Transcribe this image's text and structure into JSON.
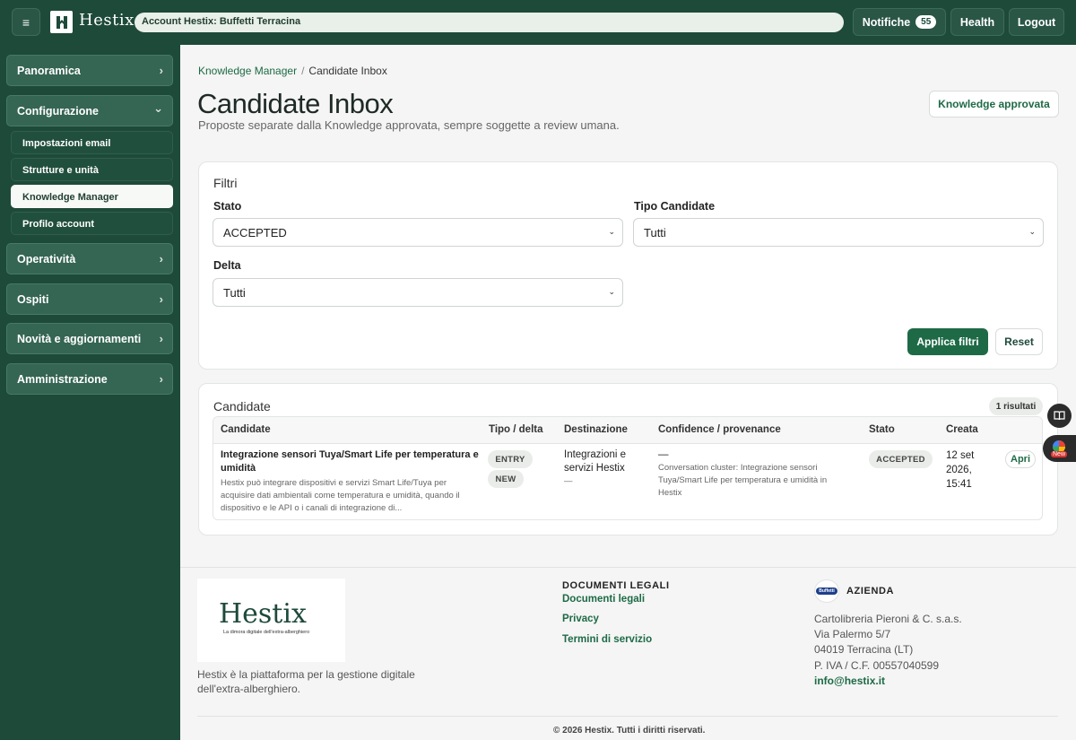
{
  "header": {
    "menu_icon": "hamburger-icon",
    "logo_text": "Hestix",
    "account_label": "Account Hestix:",
    "account_name": "Buffetti Terracina",
    "notifiche_label": "Notifiche",
    "notifiche_count": "55",
    "health_label": "Health",
    "logout_label": "Logout"
  },
  "sidebar": {
    "sections": [
      {
        "label": "Panoramica",
        "chevron": "›"
      },
      {
        "label": "Configurazione",
        "chevron": "⌄"
      },
      {
        "label": "Operatività",
        "chevron": "›"
      },
      {
        "label": "Ospiti",
        "chevron": "›"
      },
      {
        "label": "Novità e aggiornamenti",
        "chevron": "›"
      },
      {
        "label": "Amministrazione",
        "chevron": "›"
      }
    ],
    "sub_items": [
      {
        "label": "Impostazioni email"
      },
      {
        "label": "Strutture e unità"
      },
      {
        "label": "Knowledge Manager",
        "active": true
      },
      {
        "label": "Profilo account"
      }
    ]
  },
  "breadcrumb": {
    "parent": "Knowledge Manager",
    "separator": "/",
    "current": "Candidate Inbox"
  },
  "page": {
    "title": "Candidate Inbox",
    "subtitle": "Proposte separate dalla Knowledge approvata, sempre soggette a review umana.",
    "kb_button": "Knowledge approvata"
  },
  "filters": {
    "title": "Filtri",
    "stato_label": "Stato",
    "stato_value": "ACCEPTED",
    "tipo_label": "Tipo Candidate",
    "tipo_value": "Tutti",
    "delta_label": "Delta",
    "delta_value": "Tutti",
    "apply_label": "Applica filtri",
    "reset_label": "Reset"
  },
  "candidates": {
    "title": "Candidate",
    "count": "1 risultati",
    "columns": [
      "Candidate",
      "Tipo / delta",
      "Destinazione",
      "Confidence / provenance",
      "Stato",
      "Creata"
    ],
    "rows": [
      {
        "title": "Integrazione sensori Tuya/Smart Life per temperatura e umidità",
        "description": "Hestix può integrare dispositivi e servizi Smart Life/Tuya per acquisire dati ambientali come temperatura e umidità, quando il dispositivo e le API o i canali di integrazione di...",
        "tipo": "ENTRY",
        "delta": "NEW",
        "destinazione": "Integrazioni e servizi Hestix",
        "destinazione_sub": "—",
        "confidence": "—",
        "provenance": "Conversation cluster: Integrazione sensori Tuya/Smart Life per temperatura e umidità in Hestix",
        "stato": "ACCEPTED",
        "creata": "12 set 2026, 15:41",
        "action": "Apri"
      }
    ]
  },
  "footer": {
    "logo_word": "Hestix",
    "logo_tagline": "La dimora digitale dell'extra-alberghiero",
    "description": "Hestix è la piattaforma per la gestione digitale dell'extra-alberghiero.",
    "legal_head": "DOCUMENTI LEGALI",
    "legal_links": [
      "Documenti legali",
      "Privacy",
      "Termini di servizio"
    ],
    "company_head": "AZIENDA",
    "company_icon_text": "Buffetti",
    "company_lines": [
      "Cartolibreria Pieroni & C. s.a.s.",
      "Via Palermo 5/7",
      "04019 Terracina (LT)",
      "P. IVA / C.F. 00557040599"
    ],
    "company_email": "info@hestix.it",
    "copyright": "© 2026 Hestix. Tutti i diritti riservati."
  },
  "floating": {
    "book_icon": "book-icon",
    "new_label": "New"
  },
  "colors": {
    "brand_dark": "#1e4a3a",
    "accent": "#1e6a47"
  }
}
